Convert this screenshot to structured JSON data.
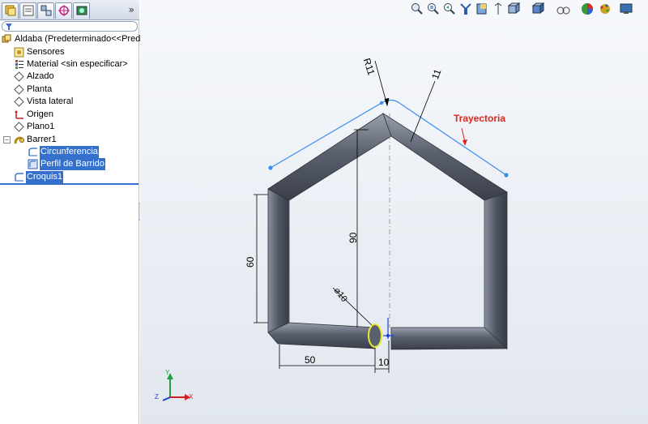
{
  "feature_tree": {
    "root": "Aldaba  (Predeterminado<<Prede",
    "items": [
      {
        "label": "Sensores",
        "icon": "sensors-icon"
      },
      {
        "label": "Material <sin especificar>",
        "icon": "material-icon"
      },
      {
        "label": "Alzado",
        "icon": "plane-icon"
      },
      {
        "label": "Planta",
        "icon": "plane-icon"
      },
      {
        "label": "Vista lateral",
        "icon": "plane-icon"
      },
      {
        "label": "Origen",
        "icon": "origin-icon"
      },
      {
        "label": "Plano1",
        "icon": "plane-icon"
      }
    ],
    "sweep": {
      "label": "Barrer1",
      "children": [
        {
          "label": "Circunferencia",
          "icon": "sketch-icon"
        },
        {
          "label": "Perfil de Barrido",
          "icon": "sketch-profile-icon"
        }
      ]
    },
    "sketch": {
      "label": "Croquis1",
      "icon": "sketch-icon"
    }
  },
  "panel_tabs": [
    "feature-manager-icon",
    "property-manager-icon",
    "configuration-manager-icon",
    "dimxpert-icon",
    "display-manager-icon"
  ],
  "panel_chevron": "»",
  "view_toolbar": [
    "zoom-to-fit-icon",
    "zoom-area-icon",
    "previous-view-icon",
    "section-view-icon",
    "view-orientation-icon",
    "dynamic-annotation-icon",
    "display-style-icon",
    "hide-show-icon",
    "edit-appearance-icon",
    "apply-scene-icon",
    "view-settings-icon"
  ],
  "annotations": {
    "trajectory": "Trayectoria",
    "r11": "R11",
    "d11": "11",
    "d60": "60",
    "d90": "90",
    "d10": "⌀10",
    "d50": "50",
    "d10b": "10"
  },
  "triad": {
    "x": "X",
    "y": "Y",
    "z": "Z"
  },
  "colors": {
    "selection": "#3470cc",
    "tube": "#5a6070",
    "sketch": "#3a8ff0",
    "callout": "#d9281e"
  }
}
